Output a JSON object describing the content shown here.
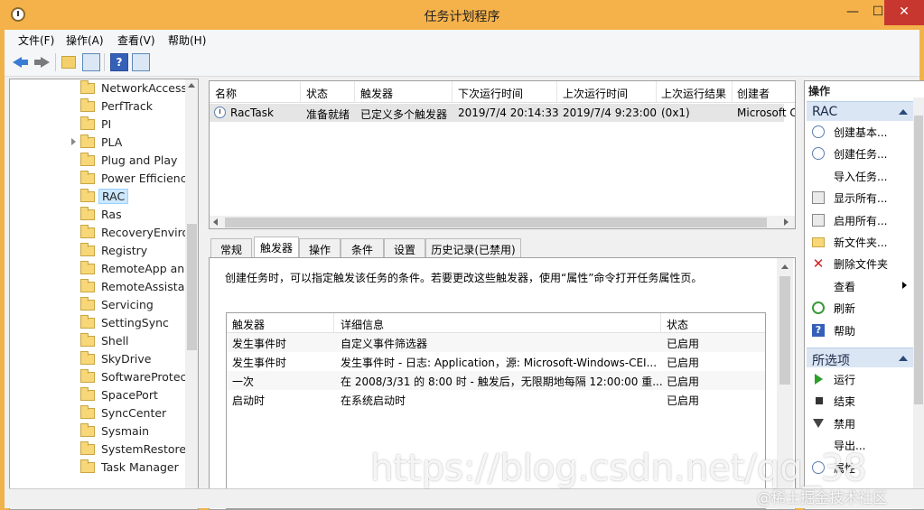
{
  "window": {
    "title": "任务计划程序",
    "min_symbol": "—",
    "max_symbol": "☐",
    "close_symbol": "✕"
  },
  "menu": [
    {
      "label": "文件(F)"
    },
    {
      "label": "操作(A)"
    },
    {
      "label": "查看(V)"
    },
    {
      "label": "帮助(H)"
    }
  ],
  "toolbar": {
    "icons": [
      "back-arrow-icon",
      "forward-arrow-icon",
      "folder-up-icon",
      "show-hide-console-tree-icon",
      "help-icon",
      "show-hide-action-pane-icon"
    ],
    "help_label": "?"
  },
  "tree": {
    "items": [
      {
        "label": "NetworkAccessP",
        "expandable": false
      },
      {
        "label": "PerfTrack",
        "expandable": false
      },
      {
        "label": "PI",
        "expandable": false
      },
      {
        "label": "PLA",
        "expandable": true
      },
      {
        "label": "Plug and Play",
        "expandable": false
      },
      {
        "label": "Power Efficiency",
        "expandable": false
      },
      {
        "label": "RAC",
        "expandable": false,
        "selected": true
      },
      {
        "label": "Ras",
        "expandable": false
      },
      {
        "label": "RecoveryEnviron",
        "expandable": false
      },
      {
        "label": "Registry",
        "expandable": false
      },
      {
        "label": "RemoteApp and",
        "expandable": false
      },
      {
        "label": "RemoteAssistan",
        "expandable": false
      },
      {
        "label": "Servicing",
        "expandable": false
      },
      {
        "label": "SettingSync",
        "expandable": false
      },
      {
        "label": "Shell",
        "expandable": false
      },
      {
        "label": "SkyDrive",
        "expandable": false
      },
      {
        "label": "SoftwareProtect",
        "expandable": false
      },
      {
        "label": "SpacePort",
        "expandable": false
      },
      {
        "label": "SyncCenter",
        "expandable": false
      },
      {
        "label": "Sysmain",
        "expandable": false
      },
      {
        "label": "SystemRestore",
        "expandable": false
      },
      {
        "label": "Task Manager",
        "expandable": false
      }
    ]
  },
  "task_list": {
    "columns": [
      "名称",
      "状态",
      "触发器",
      "下次运行时间",
      "上次运行时间",
      "上次运行结果",
      "创建者"
    ],
    "rows": [
      {
        "name": "RacTask",
        "status": "准备就绪",
        "trigger": "已定义多个触发器",
        "next_run": "2019/7/4 20:14:33",
        "last_run": "2019/7/4 9:23:00",
        "last_result": "(0x1)",
        "author": "Microsoft C"
      }
    ]
  },
  "tabs": [
    {
      "label": "常规"
    },
    {
      "label": "触发器",
      "active": true
    },
    {
      "label": "操作"
    },
    {
      "label": "条件"
    },
    {
      "label": "设置"
    },
    {
      "label": "历史记录(已禁用)"
    }
  ],
  "triggers_tab": {
    "description": "创建任务时，可以指定触发该任务的条件。若要更改这些触发器，使用“属性”命令打开任务属性页。",
    "columns": [
      "触发器",
      "详细信息",
      "状态"
    ],
    "rows": [
      {
        "trigger": "发生事件时",
        "details": "自定义事件筛选器",
        "status": "已启用"
      },
      {
        "trigger": "发生事件时",
        "details": "发生事件时 - 日志: Application，源: Microsoft-Windows-CEI...",
        "status": "已启用"
      },
      {
        "trigger": "一次",
        "details": "在 2008/3/31 的 8:00 时 - 触发后，无限期地每隔 12:00:00 重...",
        "status": "已启用"
      },
      {
        "trigger": "启动时",
        "details": "在系统启动时",
        "status": "已启用"
      }
    ]
  },
  "actions": {
    "title": "操作",
    "section1": {
      "label": "RAC",
      "items": [
        {
          "label": "创建基本...",
          "icon": "create-basic-task-icon"
        },
        {
          "label": "创建任务...",
          "icon": "create-task-icon"
        },
        {
          "label": "导入任务...",
          "icon": ""
        },
        {
          "label": "显示所有...",
          "icon": "display-running-tasks-icon"
        },
        {
          "label": "启用所有...",
          "icon": "enable-history-icon"
        },
        {
          "label": "新文件夹...",
          "icon": "new-folder-icon"
        },
        {
          "label": "删除文件夹",
          "icon": "delete-icon"
        },
        {
          "label": "查看",
          "icon": "",
          "submenu": true
        },
        {
          "label": "刷新",
          "icon": "refresh-icon"
        },
        {
          "label": "帮助",
          "icon": "help-icon"
        }
      ]
    },
    "section2": {
      "label": "所选项",
      "items": [
        {
          "label": "运行",
          "icon": "run-icon"
        },
        {
          "label": "结束",
          "icon": "end-icon"
        },
        {
          "label": "禁用",
          "icon": "disable-icon"
        },
        {
          "label": "导出...",
          "icon": ""
        },
        {
          "label": "属性",
          "icon": "properties-icon"
        }
      ]
    }
  },
  "watermark": {
    "url": "https://blog.csdn.net/qq_38",
    "brand": "@稀土掘金技术社区"
  }
}
